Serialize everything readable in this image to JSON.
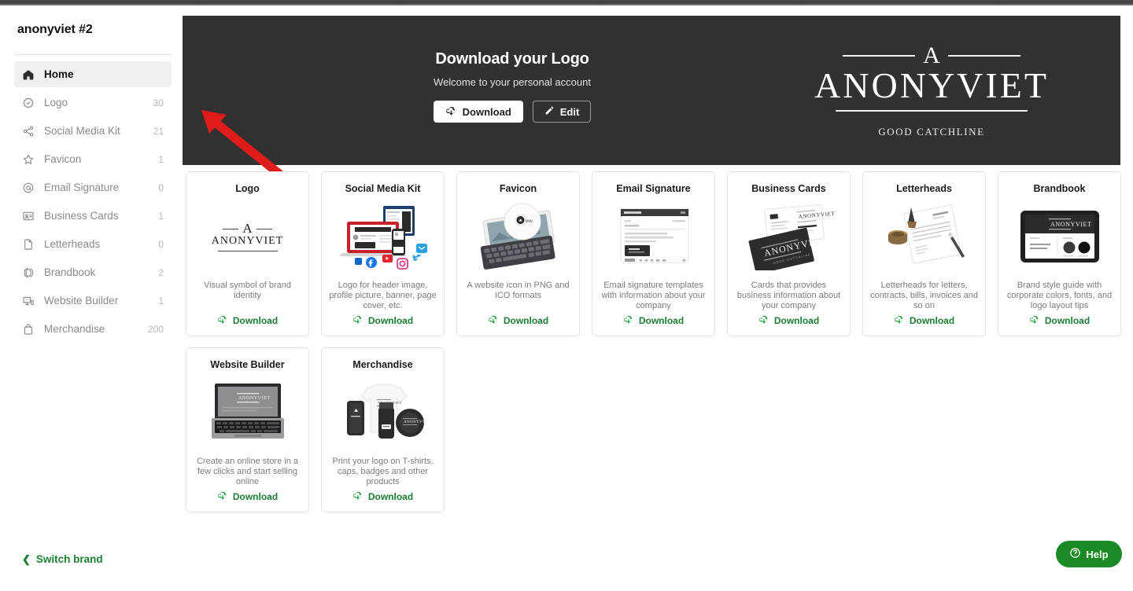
{
  "sidebar": {
    "brand_name": "anonyviet #2",
    "items": [
      {
        "label": "Home",
        "count": "",
        "icon": "home-icon",
        "active": true
      },
      {
        "label": "Logo",
        "count": "30",
        "icon": "badge-check-icon",
        "active": false
      },
      {
        "label": "Social Media Kit",
        "count": "21",
        "icon": "share-icon",
        "active": false
      },
      {
        "label": "Favicon",
        "count": "1",
        "icon": "star-icon",
        "active": false
      },
      {
        "label": "Email Signature",
        "count": "0",
        "icon": "at-sign-icon",
        "active": false
      },
      {
        "label": "Business Cards",
        "count": "1",
        "icon": "id-card-icon",
        "active": false
      },
      {
        "label": "Letterheads",
        "count": "0",
        "icon": "document-icon",
        "active": false
      },
      {
        "label": "Brandbook",
        "count": "2",
        "icon": "book-pages-icon",
        "active": false
      },
      {
        "label": "Website Builder",
        "count": "1",
        "icon": "monitor-icon",
        "active": false
      },
      {
        "label": "Merchandise",
        "count": "200",
        "icon": "shopping-bag-icon",
        "active": false
      }
    ],
    "switch_brand_label": "Switch brand"
  },
  "hero": {
    "title": "Download your Logo",
    "subtitle": "Welcome to your personal account",
    "download_label": "Download",
    "edit_label": "Edit",
    "logo": {
      "initial": "A",
      "name": "ANONYVIET",
      "catchline": "GOOD CATCHLINE"
    }
  },
  "cards": [
    {
      "title": "Logo",
      "desc": "Visual symbol of brand identity",
      "action": "Download",
      "thumb": "logo-wordmark-thumb"
    },
    {
      "title": "Social Media Kit",
      "desc": "Logo for header image, profile picture, banner, page cover, etc.",
      "action": "Download",
      "thumb": "social-devices-thumb"
    },
    {
      "title": "Favicon",
      "desc": "A website icon in PNG and ICO formats",
      "action": "Download",
      "thumb": "tablet-favicon-thumb"
    },
    {
      "title": "Email Signature",
      "desc": "Email signature templates with information about your company",
      "action": "Download",
      "thumb": "email-window-thumb"
    },
    {
      "title": "Business Cards",
      "desc": "Cards that provides business information about your company",
      "action": "Download",
      "thumb": "business-cards-thumb"
    },
    {
      "title": "Letterheads",
      "desc": "Letterheads for letters, contracts, bills, invoices and so on",
      "action": "Download",
      "thumb": "letterhead-pen-thumb"
    },
    {
      "title": "Brandbook",
      "desc": "Brand style guide with corporate colors, fonts, and logo layout tips",
      "action": "Download",
      "thumb": "brandbook-tablet-thumb"
    },
    {
      "title": "Website Builder",
      "desc": "Create an online store in a few clicks and start selling online",
      "action": "Download",
      "thumb": "laptop-thumb"
    },
    {
      "title": "Merchandise",
      "desc": "Print your logo on T-shirts, caps, badges and other products",
      "action": "Download",
      "thumb": "merch-shirt-thumb"
    }
  ],
  "help": {
    "label": "Help"
  },
  "colors": {
    "accent_green": "#1e7e34",
    "help_green": "#1a8a25",
    "banner_dark": "#313131",
    "annotation_red": "#e01b1b"
  }
}
